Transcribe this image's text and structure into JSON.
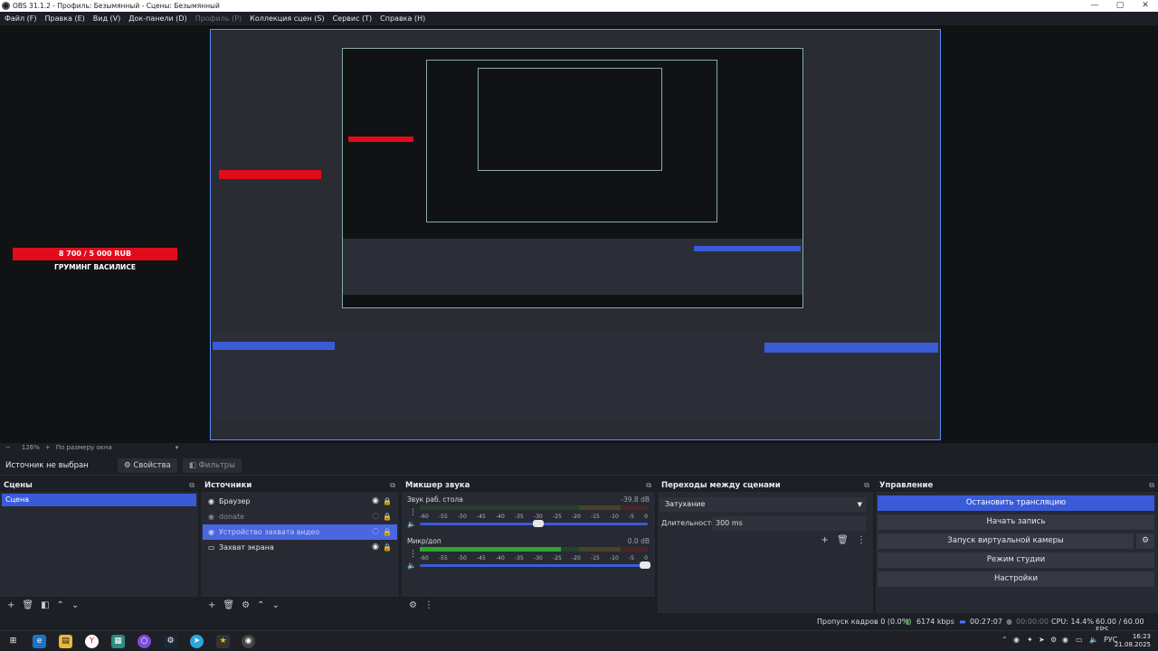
{
  "window": {
    "title": "OBS 31.1.2 - Профиль: Безымянный - Сцены: Безымянный",
    "minimize": "—",
    "maximize": "▢",
    "close": "✕"
  },
  "menu": [
    {
      "label": "Файл (F)",
      "dim": false
    },
    {
      "label": "Правка (E)",
      "dim": false
    },
    {
      "label": "Вид (V)",
      "dim": false
    },
    {
      "label": "Док-панели (D)",
      "dim": false
    },
    {
      "label": "Профиль (P)",
      "dim": true
    },
    {
      "label": "Коллекция сцен (S)",
      "dim": false
    },
    {
      "label": "Сервис (T)",
      "dim": false
    },
    {
      "label": "Справка (H)",
      "dim": false
    }
  ],
  "overlay": {
    "price": "8 700 / 5 000 RUB",
    "name": "ГРУМИНГ ВАСИЛИСЕ"
  },
  "zoom": {
    "minus": "−",
    "value": "126%",
    "plus": "+",
    "fit": "По размеру окна",
    "arrow": "▾"
  },
  "context": {
    "label": "Источник не выбран",
    "properties": "⚙ Свойства",
    "filters": "◧ Фильтры"
  },
  "scenes": {
    "title": "Сцены",
    "items": [
      "Сцена"
    ]
  },
  "sources": {
    "title": "Источники",
    "items": [
      {
        "icon": "◉",
        "label": "Браузер",
        "eye": "◉",
        "lock": "🔒",
        "dim": false,
        "sel": false
      },
      {
        "icon": "◉",
        "label": "donate",
        "eye": "◌",
        "lock": "🔒",
        "dim": true,
        "sel": false
      },
      {
        "icon": "◉",
        "label": "Устройство захвата видео",
        "eye": "◌",
        "lock": "🔒",
        "dim": true,
        "sel": true
      },
      {
        "icon": "▭",
        "label": "Захват экрана",
        "eye": "◉",
        "lock": "🔒",
        "dim": false,
        "sel": false
      }
    ]
  },
  "mixer": {
    "title": "Микшер звука",
    "channels": [
      {
        "name": "Звук раб. стола",
        "db": "-39.8 dB",
        "level": 0.0,
        "slider": 0.52
      },
      {
        "name": "Микр/доп",
        "db": "0.0 dB",
        "level": 0.62,
        "slider": 0.99
      }
    ],
    "ticks": [
      "-60",
      "-55",
      "-50",
      "-45",
      "-40",
      "-35",
      "-30",
      "-25",
      "-20",
      "-15",
      "-10",
      "-5",
      "0"
    ]
  },
  "transitions": {
    "title": "Переходы между сценами",
    "selected": "Затухание",
    "duration_label": "Длительность",
    "duration_value": "300 ms"
  },
  "controls": {
    "title": "Управление",
    "buttons": [
      "Остановить трансляцию",
      "Начать запись",
      "Запуск виртуальной камеры",
      "Режим студии",
      "Настройки"
    ]
  },
  "status": {
    "dropped": "Пропуск кадров 0 (0.0%)",
    "bitrate": "6174 kbps",
    "live_time": "00:27:07",
    "rec_time": "00:00:00",
    "cpu": "CPU: 14.4%",
    "fps": "60.00 / 60.00 FPS"
  },
  "taskbar": {
    "lang": "РУС",
    "time": "16:23",
    "date": "21.08.2025"
  },
  "colors": {
    "accent": "#3a5bd8",
    "overlay_red": "#e10b1c",
    "meter_green": "#2fa52f",
    "meter_yellow": "#b8a12a",
    "meter_red": "#a8262e"
  }
}
